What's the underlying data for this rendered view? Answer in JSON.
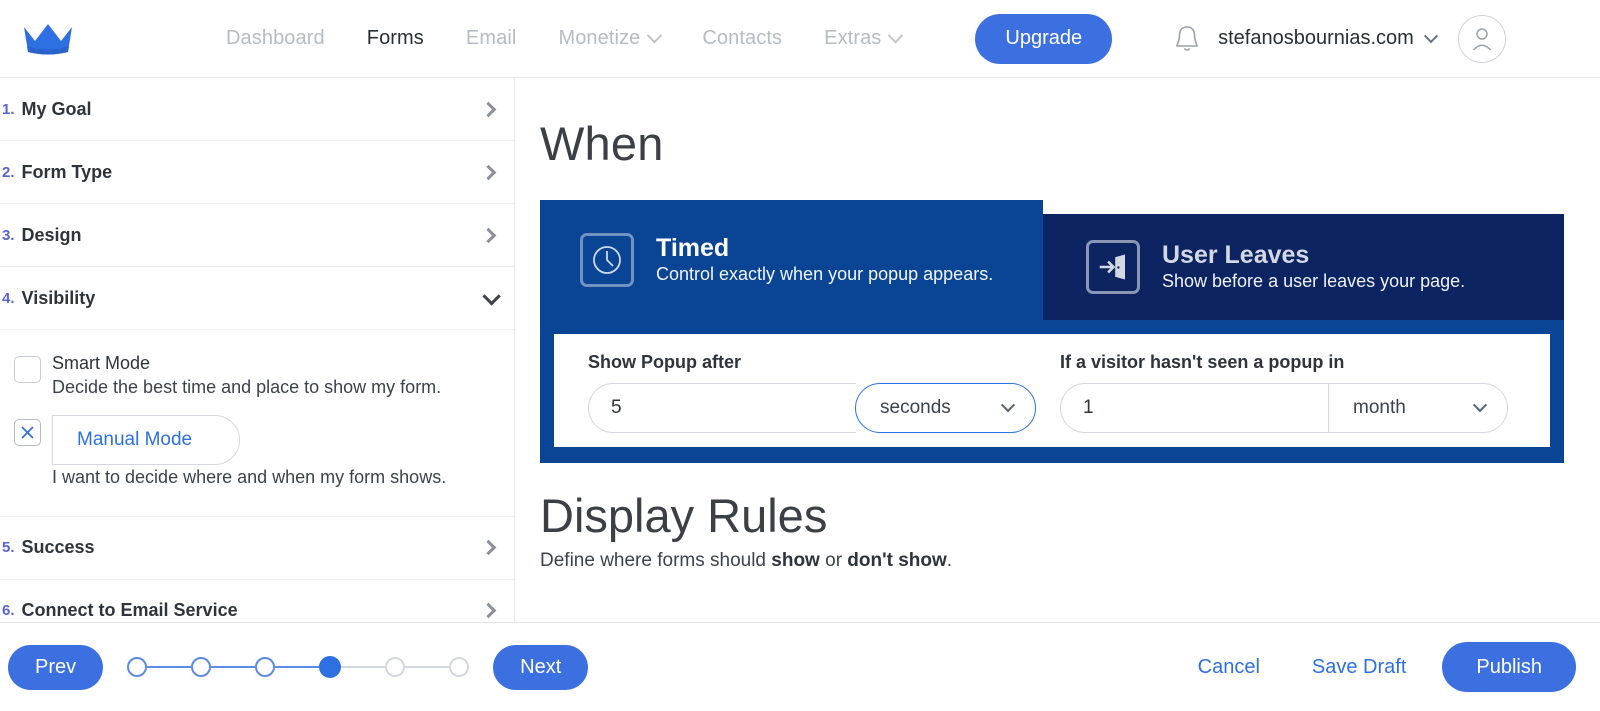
{
  "header": {
    "logo_icon": "crown-logo",
    "nav": [
      {
        "label": "Dashboard",
        "active": false,
        "caret": false
      },
      {
        "label": "Forms",
        "active": true,
        "caret": false
      },
      {
        "label": "Email",
        "active": false,
        "caret": false
      },
      {
        "label": "Monetize",
        "active": false,
        "caret": true
      },
      {
        "label": "Contacts",
        "active": false,
        "caret": false
      },
      {
        "label": "Extras",
        "active": false,
        "caret": true
      }
    ],
    "upgrade_label": "Upgrade",
    "bell_icon": "notification-bell-icon",
    "account_name": "stefanosbournias.com",
    "avatar_icon": "user-avatar-icon"
  },
  "sidebar": {
    "steps": [
      {
        "num": "1.",
        "label": "My Goal",
        "expanded": false
      },
      {
        "num": "2.",
        "label": "Form Type",
        "expanded": false
      },
      {
        "num": "3.",
        "label": "Design",
        "expanded": false
      },
      {
        "num": "4.",
        "label": "Visibility",
        "expanded": true
      },
      {
        "num": "5.",
        "label": "Success",
        "expanded": false
      },
      {
        "num": "6.",
        "label": "Connect to Email Service",
        "expanded": false
      }
    ],
    "modes": [
      {
        "title": "Smart Mode",
        "desc": "Decide the best time and place to show my form.",
        "checked": false
      },
      {
        "title": "Manual Mode",
        "desc": "I want to decide where and when my form shows.",
        "checked": true,
        "check_glyph": "✕"
      }
    ]
  },
  "main": {
    "when_title": "When",
    "tabs": [
      {
        "title": "Timed",
        "subtitle": "Control exactly when your popup appears.",
        "icon": "clock-icon",
        "active": true
      },
      {
        "title": "User Leaves",
        "subtitle": "Show before a user leaves your page.",
        "icon": "exit-door-icon",
        "active": false
      }
    ],
    "fields": {
      "delay": {
        "label": "Show Popup after",
        "value": "5",
        "unit": "seconds",
        "focused": true
      },
      "frequency": {
        "label": "If a visitor hasn't seen a popup in",
        "value": "1",
        "unit": "month",
        "focused": false
      }
    },
    "display_rules_title": "Display Rules",
    "display_rules_desc_1": "Define where forms should ",
    "display_rules_bold_1": "show",
    "display_rules_desc_2": " or ",
    "display_rules_bold_2": "don't show",
    "display_rules_desc_3": "."
  },
  "footer": {
    "prev_label": "Prev",
    "next_label": "Next",
    "steps_total": 6,
    "current_step": 4,
    "cancel_label": "Cancel",
    "save_draft_label": "Save Draft",
    "publish_label": "Publish"
  },
  "colors": {
    "brand_blue": "#3c6fe0",
    "panel_blue": "#0a4494",
    "panel_navy": "#0c2461",
    "link_blue": "#2f6fe4",
    "step_num": "#5b63d3"
  }
}
